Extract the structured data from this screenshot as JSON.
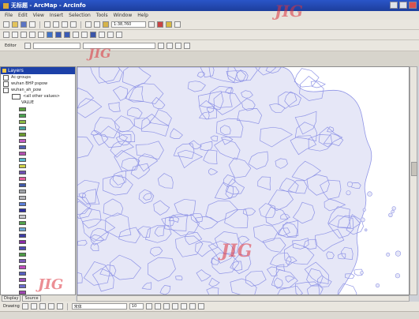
{
  "window": {
    "title": "无标题 - ArcMap - ArcInfo"
  },
  "menu": [
    "File",
    "Edit",
    "View",
    "Insert",
    "Selection",
    "Tools",
    "Window",
    "Help"
  ],
  "toolbar": {
    "scale_value": "1:38,760",
    "editor_label": "Editor"
  },
  "toc": {
    "title": "Layers",
    "layers": [
      "Ac-groups",
      "wuhan BHP pspow",
      "wuhan_ah_pow"
    ],
    "sublabel": "<all other values>",
    "field_label": "VALUE",
    "swatch_colors": [
      "#5aa13c",
      "#49a24f",
      "#8ab842",
      "#49a3a0",
      "#6b9a2e",
      "#c05bc0",
      "#4f5fb3",
      "#b34fb0",
      "#56b8cd",
      "#d0d34a",
      "#6e4fb3",
      "#e35d9a",
      "#3f58a8",
      "#9ea2a8",
      "#b7b8bc",
      "#5a7ed8",
      "#2f2fa0",
      "#c8c8d0",
      "#51a24c",
      "#6ca8d6",
      "#3c3ca6",
      "#8a2aa6",
      "#4c4cb4",
      "#4c9b44",
      "#7a5cb8",
      "#c14cc0",
      "#555fc0",
      "#9b4bb7",
      "#6c6ccf",
      "#a046b3",
      "#4b6ecf",
      "#b0a0d8",
      "#cc4cb0",
      "#2e2e8f"
    ]
  },
  "tabs": [
    "Display",
    "Source"
  ],
  "drawing": {
    "label": "Drawing",
    "font_name": "宋体",
    "font_size": "10"
  },
  "watermark": "JIG",
  "colors": {
    "titlebar": "#1d3e9c",
    "map_lines": "#8f94e6",
    "map_fill": "#e6e7f7"
  }
}
